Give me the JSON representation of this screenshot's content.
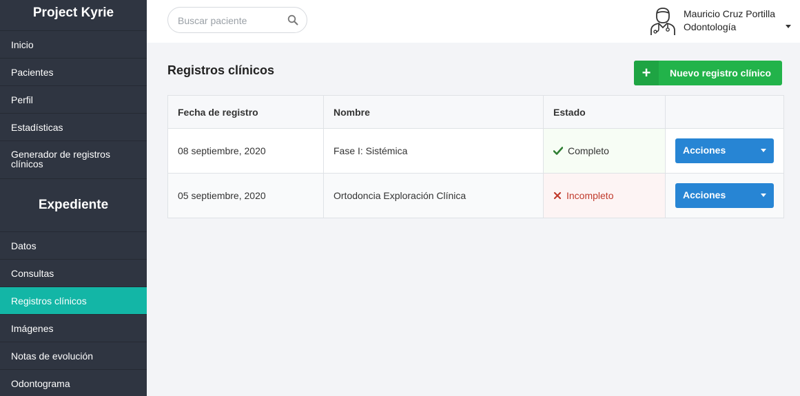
{
  "sidebar": {
    "brand": "Project Kyrie",
    "nav": [
      {
        "label": "Inicio"
      },
      {
        "label": "Pacientes"
      },
      {
        "label": "Perfil"
      },
      {
        "label": "Estadísticas"
      },
      {
        "label": "Generador de registros clínicos"
      }
    ],
    "section_title": "Expediente",
    "records_nav": [
      {
        "label": "Datos"
      },
      {
        "label": "Consultas"
      },
      {
        "label": "Registros clínicos",
        "active": true
      },
      {
        "label": "Imágenes"
      },
      {
        "label": "Notas de evolución"
      },
      {
        "label": "Odontograma"
      }
    ]
  },
  "topbar": {
    "search_placeholder": "Buscar paciente",
    "user_name": "Mauricio Cruz Portilla",
    "user_role": "Odontología"
  },
  "main": {
    "title": "Registros clínicos",
    "new_button_label": "Nuevo registro clínico",
    "table": {
      "headers": [
        "Fecha de registro",
        "Nombre",
        "Estado",
        ""
      ],
      "rows": [
        {
          "date": "08 septiembre, 2020",
          "name": "Fase I: Sistémica",
          "status": "Completo",
          "action": "Acciones"
        },
        {
          "date": "05 septiembre, 2020",
          "name": "Ortodoncia Exploración Clínica",
          "status": "Incompleto",
          "action": "Acciones"
        }
      ]
    }
  },
  "colors": {
    "sidebar_bg": "#2f3541",
    "active_item": "#13b6a6",
    "primary_green": "#22b34a",
    "action_blue": "#2785d4",
    "complete_green": "#2e7d32",
    "incomplete_red": "#c0392b"
  },
  "icons": {
    "search": "search-icon",
    "avatar": "doctor-avatar-icon",
    "plus": "plus-icon",
    "complete": "check-icon",
    "incomplete": "x-icon",
    "dropdown": "caret-down-icon"
  }
}
